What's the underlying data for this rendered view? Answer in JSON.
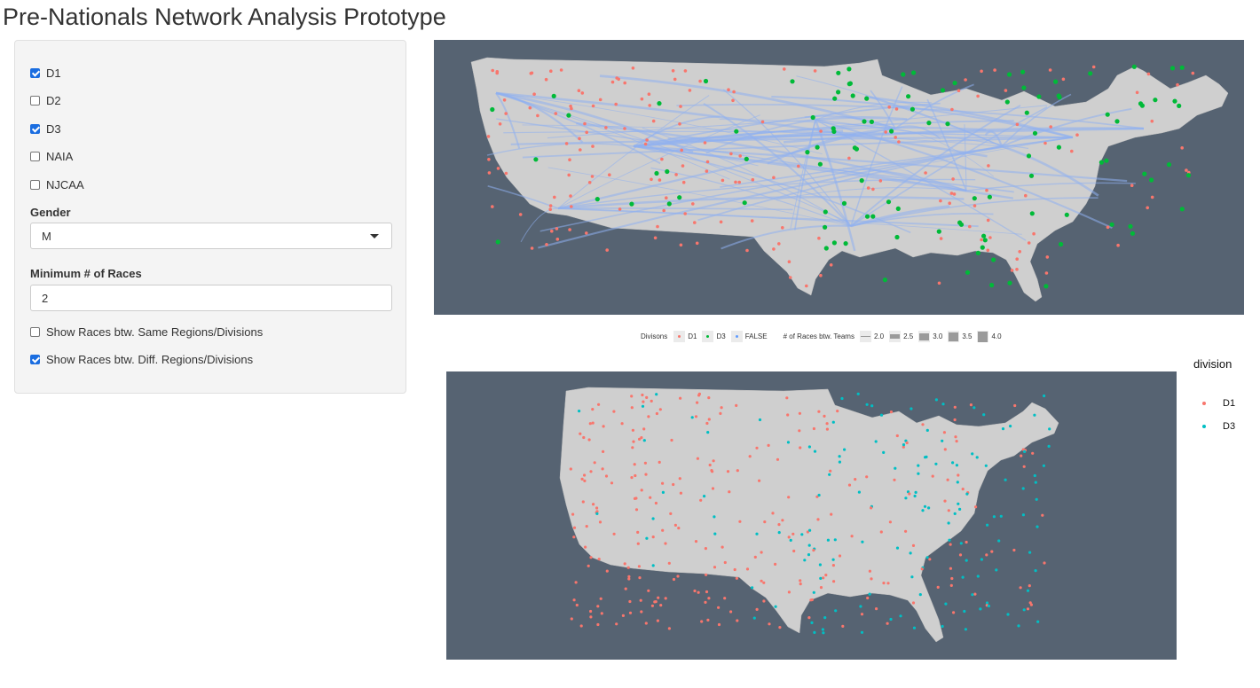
{
  "page": {
    "title": "Pre-Nationals Network Analysis Prototype"
  },
  "sidebar": {
    "divisions": [
      {
        "label": "D1",
        "checked": true
      },
      {
        "label": "D2",
        "checked": false
      },
      {
        "label": "D3",
        "checked": true
      },
      {
        "label": "NAIA",
        "checked": false
      },
      {
        "label": "NJCAA",
        "checked": false
      }
    ],
    "gender": {
      "label": "Gender",
      "value": "M"
    },
    "min_races": {
      "label": "Minimum # of Races",
      "value": "2"
    },
    "options": [
      {
        "label": "Show Races btw. Same Regions/Divisions",
        "checked": false
      },
      {
        "label": "Show Races btw. Diff. Regions/Divisions",
        "checked": true
      }
    ]
  },
  "network_legend": {
    "divisions_title": "Divisons",
    "divisions": [
      {
        "label": "D1",
        "color": "#f8766d"
      },
      {
        "label": "D3",
        "color": "#00ba38"
      },
      {
        "label": "FALSE",
        "color": "#619cff"
      }
    ],
    "races_title": "# of Races btw. Teams",
    "races": [
      "2.0",
      "2.5",
      "3.0",
      "3.5",
      "4.0"
    ]
  },
  "division_legend": {
    "title": "division",
    "items": [
      {
        "label": "D1",
        "color": "#f8766d"
      },
      {
        "label": "D3",
        "color": "#00bfc4"
      }
    ]
  },
  "colors": {
    "map_background": "#566372",
    "land": "#cfcfcf",
    "edge": "#8fb0f0"
  }
}
